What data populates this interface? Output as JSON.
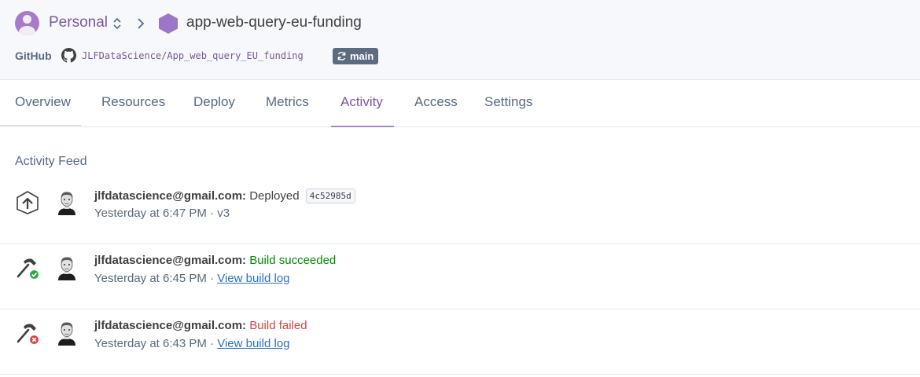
{
  "header": {
    "team": "Personal",
    "app_name": "app-web-query-eu-funding",
    "github_label": "GitHub",
    "repo": "JLFDataScience/App_web_query_EU_funding",
    "branch": "main"
  },
  "tabs": [
    {
      "label": "Overview"
    },
    {
      "label": "Resources"
    },
    {
      "label": "Deploy"
    },
    {
      "label": "Metrics"
    },
    {
      "label": "Activity",
      "active": true
    },
    {
      "label": "Access"
    },
    {
      "label": "Settings"
    }
  ],
  "feed": {
    "title": "Activity Feed",
    "items": [
      {
        "icon": "deploy-icon",
        "user": "jlfdatascience@gmail.com:",
        "action": "Deployed",
        "commit": "4c52985d",
        "time": "Yesterday at 6:47 PM",
        "sep": " · ",
        "detail": "v3"
      },
      {
        "icon": "build-success-icon",
        "user": "jlfdatascience@gmail.com:",
        "action": "Build succeeded",
        "time": "Yesterday at 6:45 PM",
        "sep": " · ",
        "link": "View build log"
      },
      {
        "icon": "build-failed-icon",
        "user": "jlfdatascience@gmail.com:",
        "action": "Build failed",
        "time": "Yesterday at 6:43 PM",
        "sep": " · ",
        "link": "View build log"
      }
    ]
  },
  "colors": {
    "brand_purple": "#79589f",
    "success": "#008b00",
    "failure": "#d64242",
    "link": "#2a6fc9"
  }
}
